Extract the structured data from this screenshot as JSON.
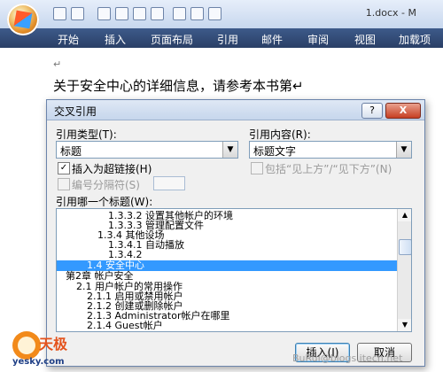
{
  "window": {
    "doc_title": "1.docx - M",
    "ribbon_tabs": [
      "开始",
      "插入",
      "页面布局",
      "引用",
      "邮件",
      "审阅",
      "视图",
      "加载项"
    ]
  },
  "document": {
    "paragraph_mark": "↵",
    "text": "关于安全中心的详细信息，请参考本书第↵"
  },
  "dialog": {
    "title": "交叉引用",
    "help_label": "?",
    "close_label": "X",
    "ref_type_label": "引用类型(T):",
    "ref_type_value": "标题",
    "ref_content_label": "引用内容(R):",
    "ref_content_value": "标题文字",
    "insert_hyperlink_label": "插入为超链接(H)",
    "insert_hyperlink_checked": true,
    "above_below_label": "包括“见上方”/“见下方”(N)",
    "separator_label": "编号分隔符(S)",
    "which_heading_label": "引用哪一个标题(W):",
    "headings": [
      "1.3.3.2 设置其他帐户的环境",
      "1.3.3.3 管理配置文件",
      "1.3.4 其他设场",
      "1.3.4.1 自动播放",
      "1.3.4.2",
      "1.4 安全中心",
      "第2章 帐户安全",
      "2.1 用户帐户的常用操作",
      "2.1.1 启用或禁用帐户",
      "2.1.2 创建或删除帐户",
      "2.1.3 Administrator帐户在哪里",
      "2.1.4 Guest帐户"
    ],
    "selected_index": 5,
    "insert_label": "插入(I)",
    "cancel_label": "取消"
  },
  "overlay": {
    "site_logo_text": "天极",
    "site_logo_sub": "yesky.com",
    "watermark": "BuRui@blogs.itecn.net"
  },
  "colors": {
    "selection": "#3399ff",
    "ribbon": "#2a3f66"
  }
}
